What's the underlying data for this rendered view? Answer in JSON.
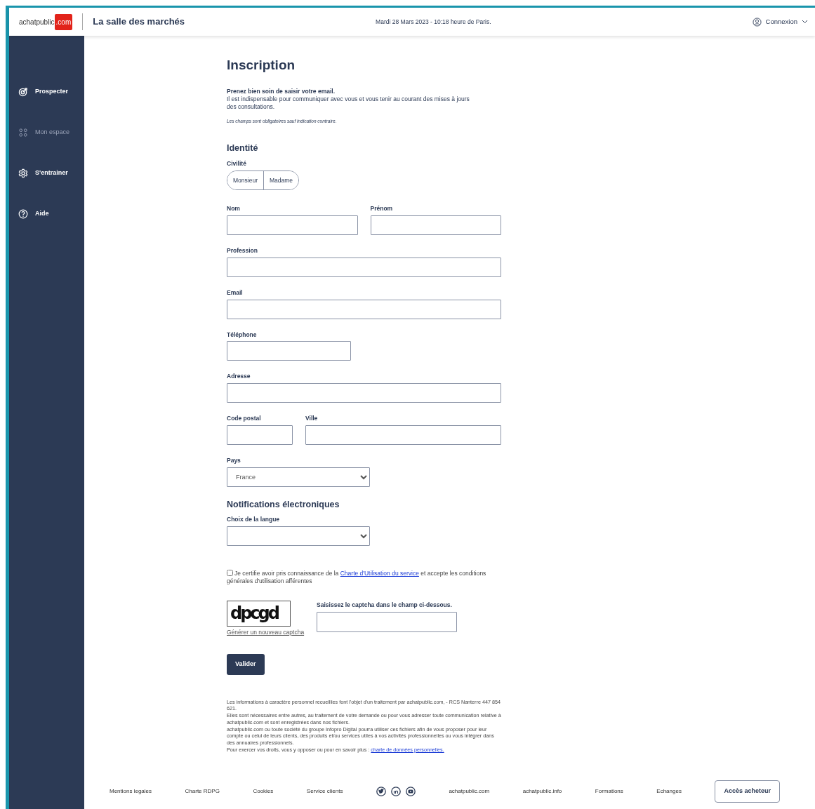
{
  "header": {
    "logo": {
      "name": "achatpublic",
      "suffix": ".com"
    },
    "title": "La salle des marchés",
    "datetime": "Mardi 28 Mars 2023 - 10:18 heure de Paris.",
    "login": "Connexion"
  },
  "sidebar": {
    "items": [
      {
        "label": "Prospecter",
        "kind": "target",
        "disabled": false
      },
      {
        "label": "Mon espace",
        "kind": "dots",
        "disabled": true
      },
      {
        "label": "S'entrainer",
        "kind": "gear",
        "disabled": false
      },
      {
        "label": "Aide",
        "kind": "help",
        "disabled": false
      }
    ]
  },
  "form": {
    "title": "Inscription",
    "intro_bold": "Prenez bien soin de saisir votre email.",
    "intro": "Il est indispensable pour communiquer avec vous et vous tenir au courant des mises à jours des consultations.",
    "required_note": "Les champs sont obligatoires sauf indication contraire.",
    "identity": {
      "heading": "Identité",
      "civility": {
        "label": "Civilité",
        "options": [
          {
            "label": "Monsieur",
            "selected": false
          },
          {
            "label": "Madame",
            "selected": false
          }
        ]
      },
      "rows": [
        [
          {
            "label": "Nom",
            "kind": "text"
          },
          {
            "label": "Prénom",
            "kind": "text"
          }
        ],
        [
          {
            "label": "Profession",
            "kind": "text"
          }
        ],
        [
          {
            "label": "Email",
            "kind": "text"
          }
        ],
        [
          {
            "label": "Téléphone",
            "kind": "tel"
          }
        ],
        [
          {
            "label": "Adresse",
            "kind": "text"
          }
        ],
        [
          {
            "label": "Code postal",
            "kind": "postal"
          },
          {
            "label": "Ville",
            "kind": "text"
          }
        ],
        [
          {
            "label": "Pays",
            "kind": "select",
            "value": "France"
          }
        ]
      ]
    },
    "notifications": {
      "heading": "Notifications électroniques",
      "language": {
        "label": "Choix de la langue",
        "kind": "select"
      }
    },
    "consent": {
      "checked": false,
      "before": "Je certifie avoir pris connaissance de la",
      "link": "Charte d'Utilisation du service",
      "after": "et accepte les conditions générales d'utilisation afférentes"
    },
    "captcha": {
      "code": "dpcgd",
      "regenerate": "Générer un nouveau captcha",
      "label": "Saisissez le captcha dans le champ ci-dessous."
    },
    "submit": "Valider",
    "privacy": {
      "lines": [
        "Les informations à caractère personnel recueillies font l'objet d'un traitement par achatpublic.com, - RCS Nanterre 447 854 621.",
        "Elles sont nécessaires entre autres, au traitement de votre demande ou pour vous adresser toute communication relative à achatpublic.com et sont enregistrées dans nos fichiers.",
        "achatpublic.com ou toute société du groupe Infopro Digital pourra utiliser ces fichiers afin de vous proposer pour leur compte ou celui de leurs clients, des produits et/ou services utiles à vos activités professionnelles ou vous intégrer dans des annuaires professionnels."
      ],
      "last": "Pour exercer vos droits, vous y opposer ou pour en savoir plus :",
      "link": "charte de données personnelles."
    }
  },
  "footer": {
    "items": [
      {
        "kind": "link",
        "label": "Mentions legales"
      },
      {
        "kind": "link",
        "label": "Charte RDPG"
      },
      {
        "kind": "link",
        "label": "Cookies"
      },
      {
        "kind": "link",
        "label": "Service clients"
      },
      {
        "kind": "social"
      },
      {
        "kind": "link",
        "label": "achatpublic.com"
      },
      {
        "kind": "link",
        "label": "achatpublic.info"
      },
      {
        "kind": "link",
        "label": "Formations"
      },
      {
        "kind": "link",
        "label": "Echanges"
      },
      {
        "kind": "button",
        "label": "Accès acheteur"
      }
    ]
  }
}
